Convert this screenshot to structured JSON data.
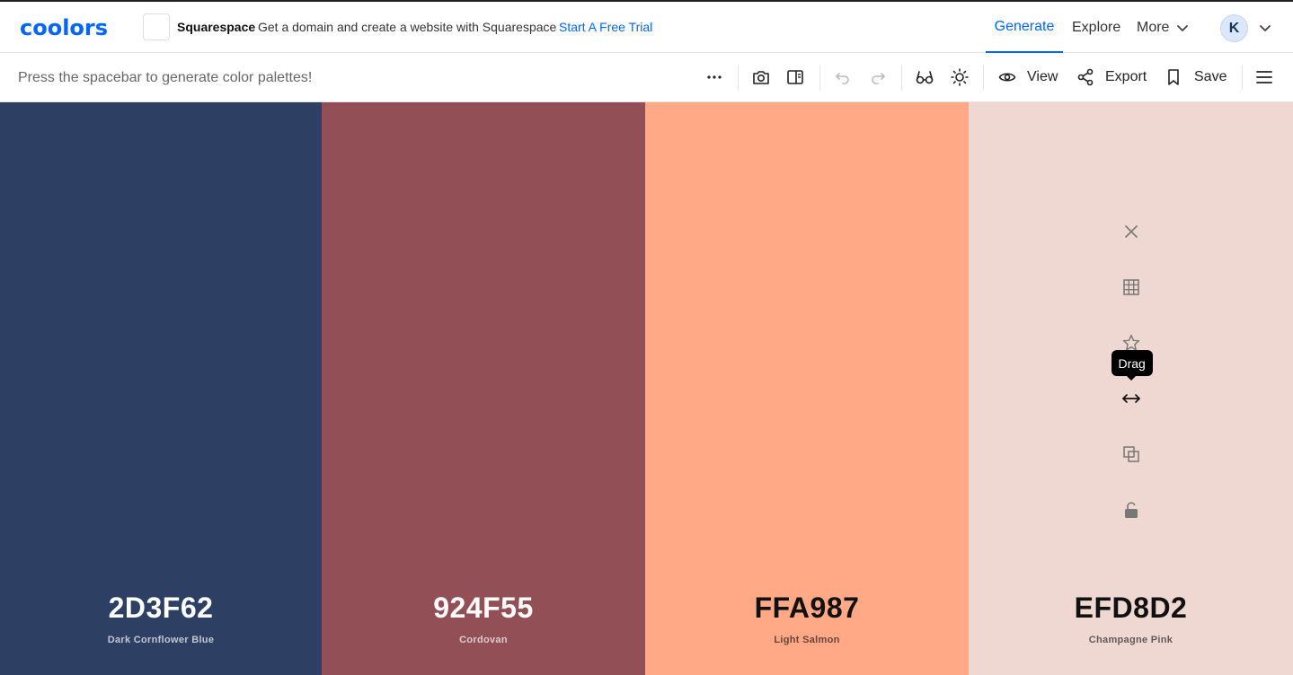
{
  "header": {
    "logo_text": "coolors",
    "ad": {
      "brand": "Squarespace",
      "text": "Get a domain and create a website with Squarespace",
      "cta": "Start A Free Trial"
    },
    "nav": {
      "generate": "Generate",
      "explore": "Explore",
      "more": "More"
    },
    "avatar_initial": "K"
  },
  "toolbar": {
    "hint": "Press the spacebar to generate color palettes!",
    "view_label": "View",
    "export_label": "Export",
    "save_label": "Save",
    "icons": [
      "more-icon",
      "camera-icon",
      "sidebar-icon",
      "undo-icon",
      "redo-icon",
      "glasses-icon",
      "sun-icon",
      "eye-icon",
      "share-icon",
      "bookmark-icon",
      "menu-icon"
    ]
  },
  "palette": [
    {
      "hex": "2D3F62",
      "name": "Dark Cornflower Blue",
      "color": "#2D3F62",
      "text": "light"
    },
    {
      "hex": "924F55",
      "name": "Cordovan",
      "color": "#924F55",
      "text": "light"
    },
    {
      "hex": "FFA987",
      "name": "Light Salmon",
      "color": "#FFA987",
      "text": "dark"
    },
    {
      "hex": "EFD8D2",
      "name": "Champagne Pink",
      "color": "#EFD8D2",
      "text": "dark"
    }
  ],
  "hovered_swatch": {
    "index": 3,
    "tools": [
      "close-icon",
      "grid-icon",
      "star-icon",
      "drag-icon",
      "copy-icon",
      "unlock-icon"
    ],
    "tooltip": "Drag"
  }
}
